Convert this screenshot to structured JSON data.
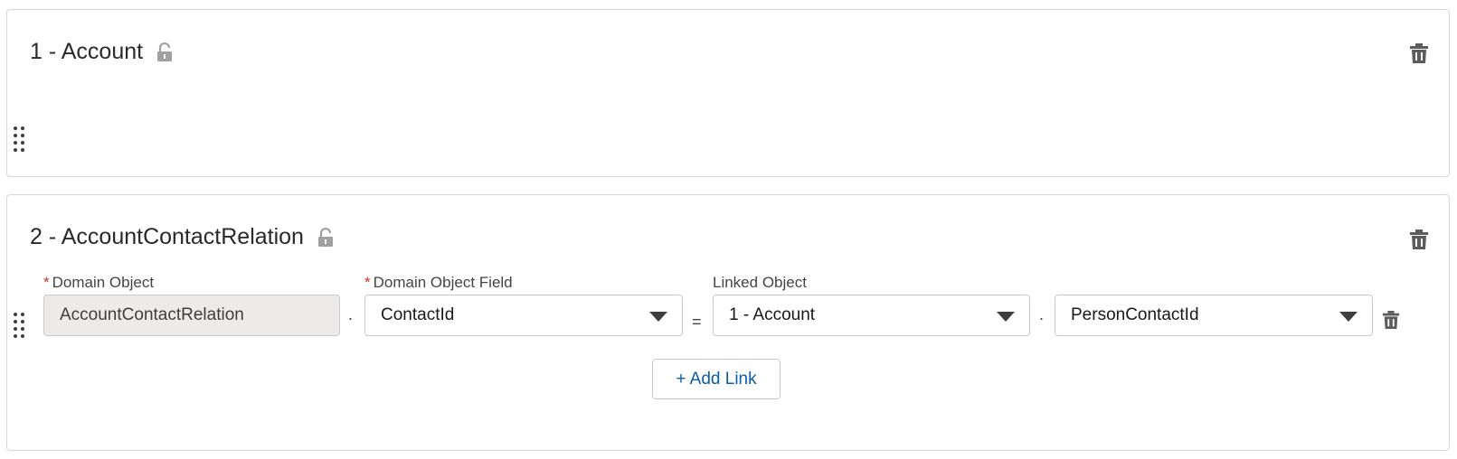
{
  "sections": [
    {
      "title": "1 - Account",
      "lock_icon": "unlock-icon",
      "delete_icon": "trash-icon",
      "drag_icon": "drag-handle-icon"
    },
    {
      "title": "2 - AccountContactRelation",
      "lock_icon": "unlock-icon",
      "delete_icon": "trash-icon",
      "drag_icon": "drag-handle-icon"
    }
  ],
  "link_row": {
    "domain_object": {
      "label": "Domain Object",
      "required_marker": "*",
      "value": "AccountContactRelation"
    },
    "dot_separator": ".",
    "domain_object_field": {
      "label": "Domain Object Field",
      "required_marker": "*",
      "value": "ContactId"
    },
    "equals_separator": "=",
    "linked_object": {
      "label": "Linked Object",
      "value": "1 - Account"
    },
    "dot_separator_2": ".",
    "linked_field": {
      "value": "PersonContactId"
    }
  },
  "add_link_label": "+ Add Link",
  "colors": {
    "required": "#c23934",
    "link": "#0b5cab",
    "readonly_bg": "#ecebea",
    "border": "#c9c9c9"
  }
}
